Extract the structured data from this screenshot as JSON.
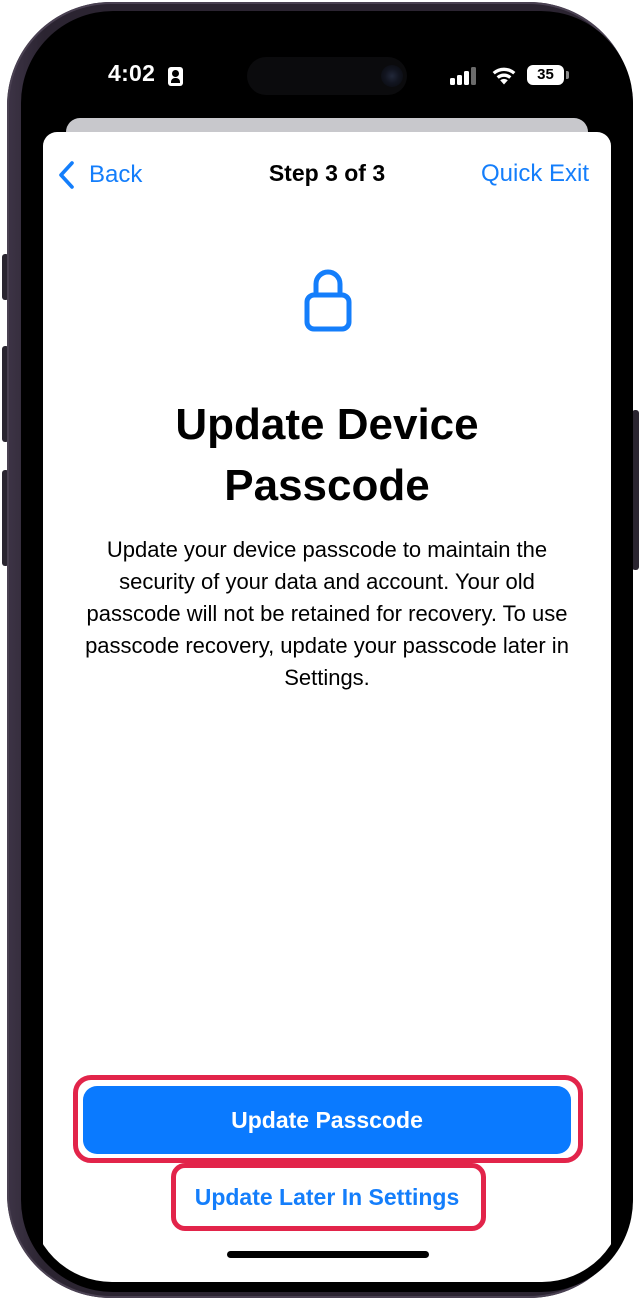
{
  "status_bar": {
    "time": "4:02",
    "battery_level": "35",
    "icons": [
      "person-badge-icon",
      "signal-icon",
      "wifi-icon",
      "battery-icon"
    ]
  },
  "nav": {
    "back_label": "Back",
    "step_title": "Step 3 of 3",
    "quick_exit_label": "Quick Exit"
  },
  "main": {
    "icon": "lock-icon",
    "title": "Update Device Passcode",
    "description": "Update your device passcode to maintain the security of your data and account. Your old passcode will not be retained for recovery. To use passcode recovery, update your passcode later in Settings."
  },
  "actions": {
    "primary_label": "Update Passcode",
    "secondary_label": "Update Later In Settings"
  },
  "colors": {
    "accent": "#147efb",
    "primary_button": "#0a7aff",
    "highlight": "#e2244a",
    "frame": "#2b2431"
  }
}
